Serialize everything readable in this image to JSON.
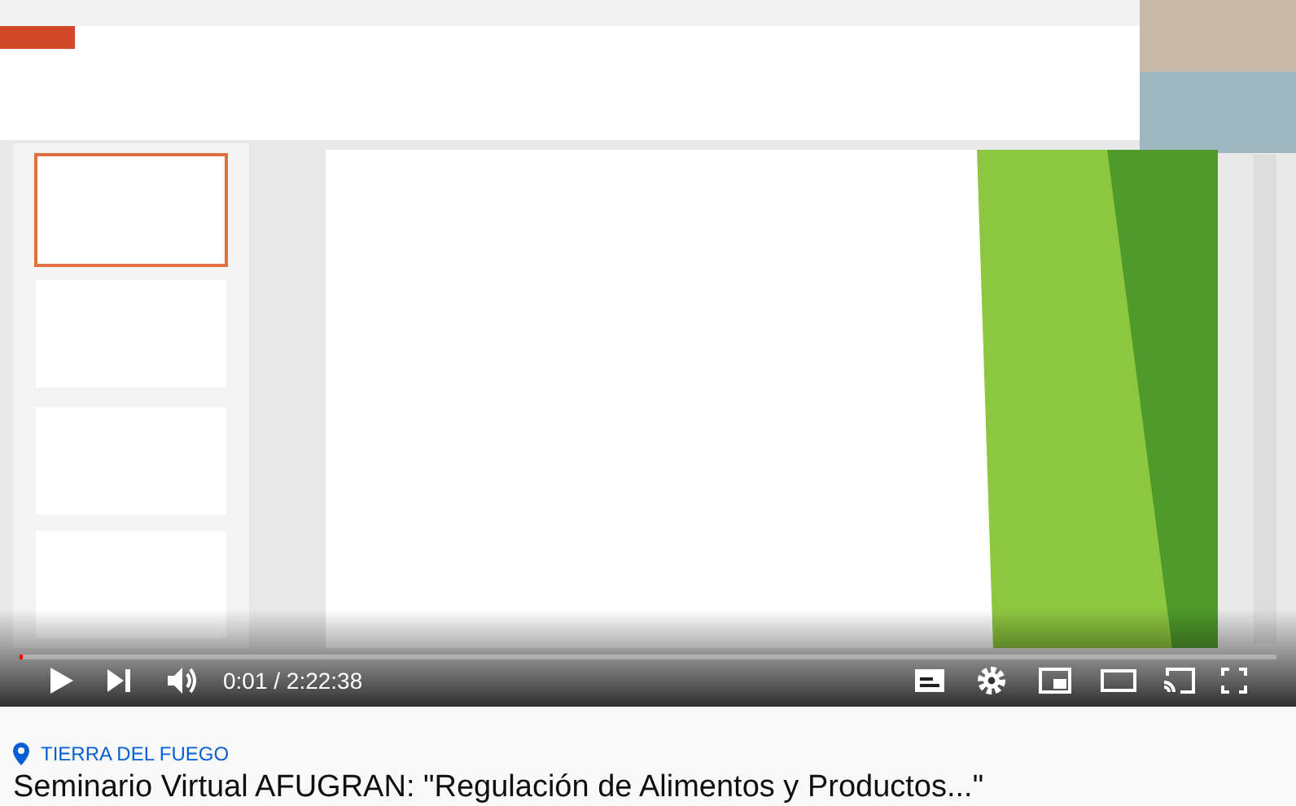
{
  "player": {
    "kind": "picture",
    "progress": {
      "level": 0.002
    },
    "time": "0:01 / 2:22:38"
  },
  "location": "TIERRA DEL FUEGO",
  "video_title": "Seminario Virtual AFUGRAN: \"Regulación de Alimentos y Productos...\""
}
